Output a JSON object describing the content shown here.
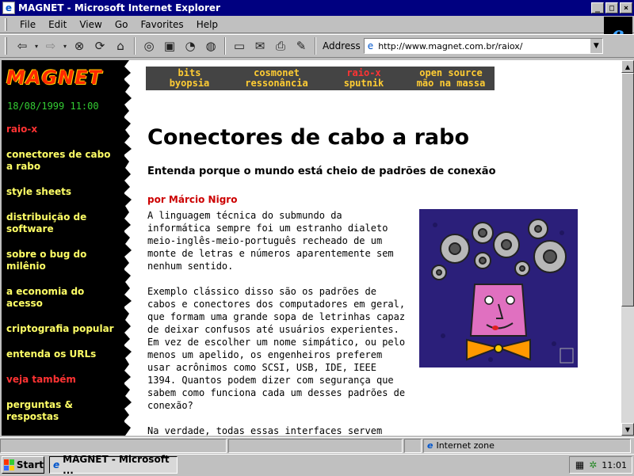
{
  "window": {
    "title": "MAGNET - Microsoft Internet Explorer",
    "buttons": {
      "minimize": "_",
      "maximize": "□",
      "close": "×"
    }
  },
  "menu": [
    "File",
    "Edit",
    "View",
    "Go",
    "Favorites",
    "Help"
  ],
  "toolbar": {
    "buttons": [
      "back-icon",
      "forward-icon",
      "stop-icon",
      "refresh-icon",
      "home-icon",
      "search-icon",
      "favorites-icon",
      "history-icon",
      "channels-icon",
      "fullscreen-icon",
      "mail-icon",
      "print-icon",
      "edit-icon"
    ],
    "address_label": "Address",
    "address_url": "http://www.magnet.com.br/raiox/"
  },
  "page": {
    "logo": "MAGNET",
    "datetime": "18/08/1999 11:00",
    "topnav": [
      {
        "line1": "bits",
        "line2": "byopsia",
        "active": false
      },
      {
        "line1": "cosmonet",
        "line2": "ressonância",
        "active": false
      },
      {
        "line1": "raio-x",
        "line2": "sputnik",
        "active": true
      },
      {
        "line1": "open source",
        "line2": "mão na massa",
        "active": false
      }
    ],
    "sidebar": [
      {
        "label": "raio-x",
        "red": true
      },
      {
        "label": "conectores de cabo a rabo",
        "red": false
      },
      {
        "label": "style sheets",
        "red": false
      },
      {
        "label": "distribuição de software",
        "red": false
      },
      {
        "label": "sobre o bug do milênio",
        "red": false
      },
      {
        "label": "a economia do acesso",
        "red": false
      },
      {
        "label": "criptografia popular",
        "red": false
      },
      {
        "label": "entenda os URLs",
        "red": false
      },
      {
        "label": "veja também",
        "red": true
      },
      {
        "label": "perguntas & respostas",
        "red": false
      }
    ],
    "article": {
      "title": "Conectores de cabo a rabo",
      "subtitle": "Entenda porque o mundo está cheio de padrões de conexão",
      "author": "por Márcio Nigro",
      "paragraphs": [
        "A linguagem técnica do submundo da informática sempre foi um estranho dialeto meio-inglês-meio-português recheado de um monte de letras e números aparentemente sem nenhum sentido.",
        "Exemplo clássico disso são os padrões de cabos e conectores dos computadores em geral, que formam uma grande sopa de letrinhas capaz de deixar confusos até usuários experientes. Em vez de escolher um nome simpático, ou pelo menos um apelido, os engenheiros preferem usar acrônimos como SCSI, USB, IDE, IEEE 1394. Quantos podem dizer com segurança que sabem como funciona cada um desses padrões de conexão?",
        "Na verdade, todas essas interfaces servem para transferir dados de um dispositivo para outro. O"
      ]
    }
  },
  "status": {
    "zone": "Internet zone"
  },
  "taskbar": {
    "start": "Start",
    "task": "MAGNET - Microsoft ...",
    "clock": "11:01"
  },
  "colors": {
    "titlebar": "#000080",
    "nav_yellow": "#ffff66",
    "nav_red": "#ff3333",
    "author_red": "#cc0000",
    "illustration_bg": "#2b1f7a"
  }
}
